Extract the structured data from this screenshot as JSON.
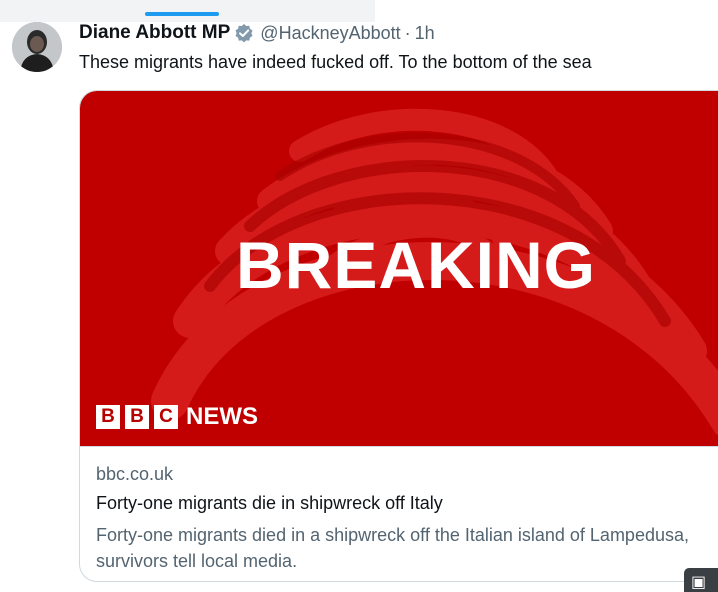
{
  "tweet": {
    "author_name": "Diane Abbott MP",
    "handle": "@HackneyAbbott",
    "separator": "·",
    "time": "1h",
    "verified": true,
    "text": "These migrants have indeed fucked off. To the bottom of the sea"
  },
  "card": {
    "image": {
      "headline_word": "BREAKING",
      "logo_letters": [
        "B",
        "B",
        "C"
      ],
      "logo_word": "NEWS",
      "background_color": "#c00000"
    },
    "domain": "bbc.co.uk",
    "title": "Forty-one migrants die in shipwreck off Italy",
    "description": "Forty-one migrants died in a shipwreck off the Italian island of Lampedusa, survivors tell local media."
  },
  "colors": {
    "accent": "#1d9bf0",
    "secondary_text": "#536471",
    "border": "#cfd9de"
  }
}
